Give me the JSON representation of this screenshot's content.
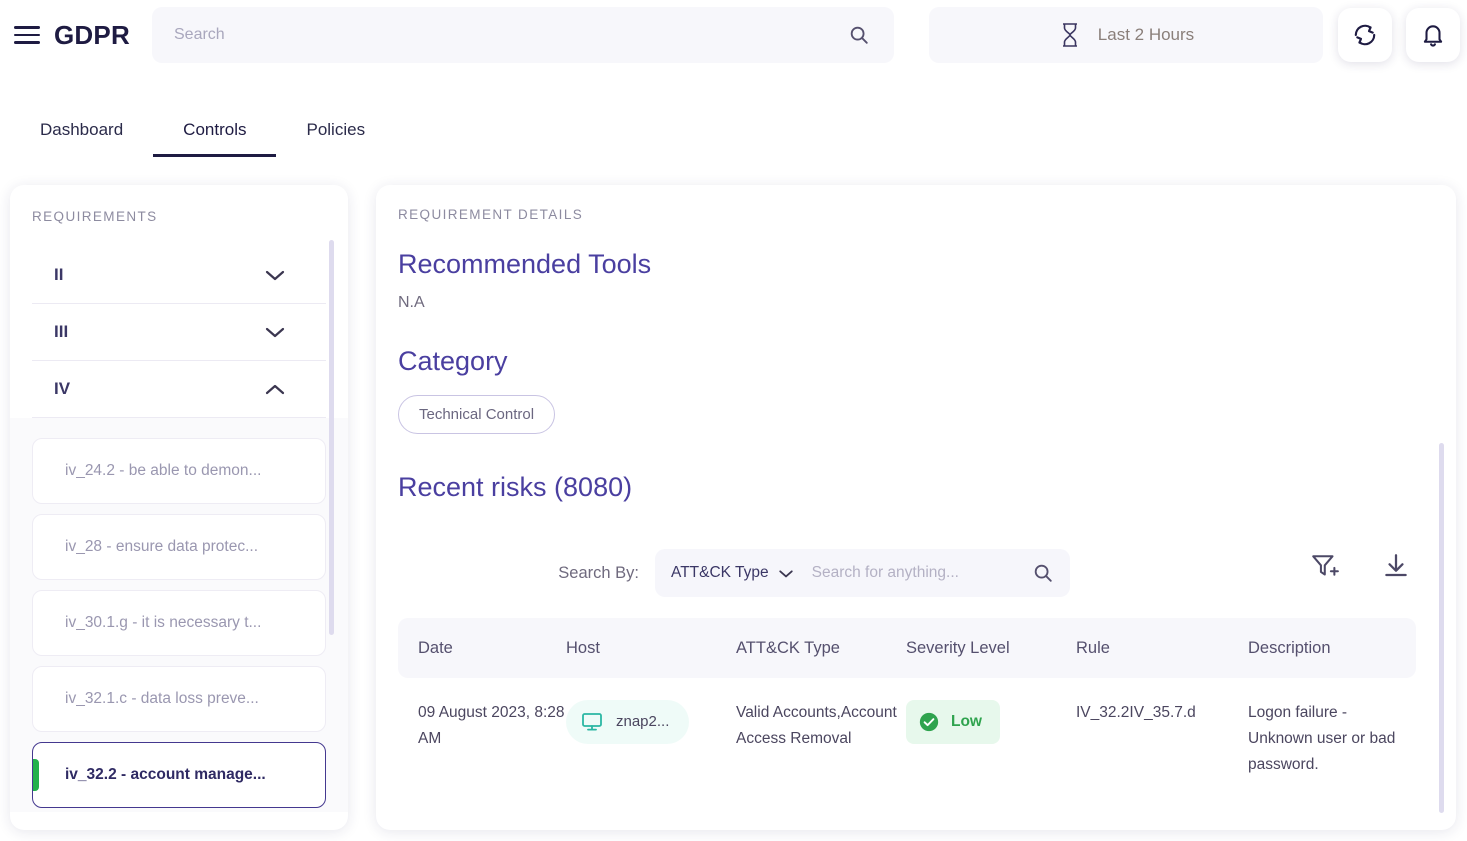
{
  "header": {
    "menu_icon": "hamburger-icon",
    "brand": "GDPR",
    "search_placeholder": "Search",
    "search_value": "",
    "search_icon": "search-icon",
    "timerange_icon": "hourglass-icon",
    "timerange_label": "Last 2 Hours",
    "refresh_icon": "refresh-icon",
    "bell_icon": "bell-icon"
  },
  "tabs": [
    {
      "label": "Dashboard",
      "active": false
    },
    {
      "label": "Controls",
      "active": true
    },
    {
      "label": "Policies",
      "active": false
    }
  ],
  "requirements_panel": {
    "title": "REQUIREMENTS",
    "groups": [
      {
        "label": "II",
        "expanded": false,
        "chevron": "chevron-down-icon"
      },
      {
        "label": "III",
        "expanded": false,
        "chevron": "chevron-down-icon"
      },
      {
        "label": "IV",
        "expanded": true,
        "chevron": "chevron-up-icon"
      }
    ],
    "items": [
      {
        "label": "iv_24.2 - be able to demon...",
        "selected": false
      },
      {
        "label": "iv_28 - ensure data protec...",
        "selected": false
      },
      {
        "label": "iv_30.1.g - it is necessary t...",
        "selected": false
      },
      {
        "label": "iv_32.1.c - data loss preve...",
        "selected": false
      },
      {
        "label": "iv_32.2 - account manage...",
        "selected": true
      }
    ]
  },
  "detail_panel": {
    "title": "REQUIREMENT DETAILS",
    "recommended_tools_heading": "Recommended Tools",
    "recommended_tools_value": "N.A",
    "category_heading": "Category",
    "category_chip": "Technical Control",
    "recent_risks_heading": "Recent risks (8080)",
    "search": {
      "search_by_label": "Search By:",
      "select_value": "ATT&CK Type",
      "select_chevron": "chevron-down-icon",
      "input_placeholder": "Search for anything...",
      "input_value": "",
      "search_icon": "search-icon",
      "filter_icon": "filter-add-icon",
      "download_icon": "download-icon"
    },
    "table": {
      "columns": [
        "Date",
        "Host",
        "ATT&CK Type",
        "Severity Level",
        "Rule",
        "Description"
      ],
      "rows": [
        {
          "date": "09 August 2023, 8:28 AM",
          "host": "znap2...",
          "host_icon": "monitor-icon",
          "attack_type": "Valid Accounts,Account Access Removal",
          "severity": "Low",
          "severity_icon": "check-circle-icon",
          "rule": "IV_32.2IV_35.7.d",
          "description": "Logon failure - Unknown user or bad password."
        }
      ]
    }
  },
  "colors": {
    "brand_navy": "#1e1b42",
    "heading_purple": "#4a3fa0",
    "selected_border": "#44388f",
    "accent_green": "#22b14c",
    "severity_low_text": "#2fa34e",
    "severity_low_bg": "#e7f8ec",
    "host_badge_bg": "#effbf8",
    "host_icon_teal": "#2bb7a3",
    "panel_bg": "#f7f7fb",
    "scrollbar": "#dedbee"
  }
}
